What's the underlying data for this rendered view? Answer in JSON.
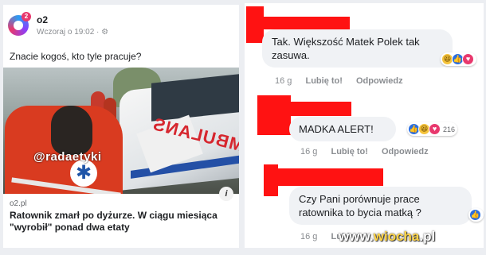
{
  "left_post": {
    "page_name": "o2",
    "logo_badge": "2",
    "timestamp": "Wczoraj o 19:02 · ⚙",
    "text": "Znacie kogoś, kto tyle pracuje?",
    "image_tag": "@radaetyki",
    "ambulance_text": "AMBULANS",
    "info_label": "i",
    "link_domain": "o2.pl",
    "link_title": "Ratownik zmarł po dyżurze. W ciągu miesiąca \"wyrobił\" ponad dwa etaty"
  },
  "comments": [
    {
      "text": "Tak. Większość Matek Polek tak zasuwa.",
      "time": "16 g",
      "like": "Lubię to!",
      "reply": "Odpowiedz",
      "count": ""
    },
    {
      "text": "MADKA ALERT!",
      "time": "16 g",
      "like": "Lubię to!",
      "reply": "Odpowiedz",
      "count": "216"
    },
    {
      "text": "Czy Pani porównuje prace ratownika to bycia matką ?",
      "time": "16 g",
      "like": "Lubię to!",
      "reply": "Odpowiedz",
      "count": ""
    }
  ],
  "watermark": {
    "prefix": "www.",
    "highlight": "wiocha",
    "suffix": ".pl"
  },
  "colors": {
    "redaction": "#ff1212",
    "like_blue": "#2b6fe0",
    "love_pink": "#e8386d",
    "haha_yellow": "#f5c33b"
  }
}
